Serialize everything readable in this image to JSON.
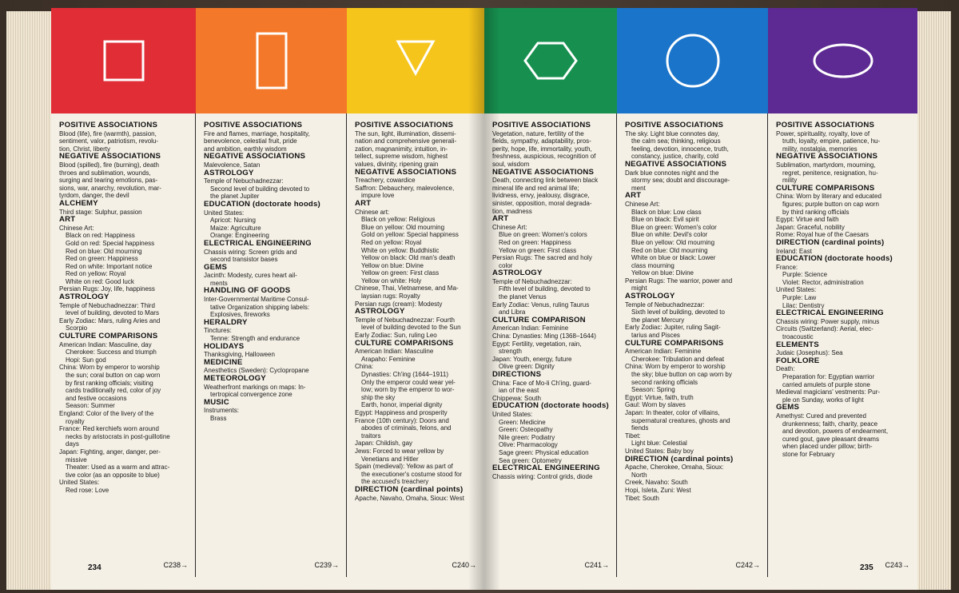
{
  "colors": {
    "red": "#e02d36",
    "orange": "#f3782a",
    "yellow": "#f6c51c",
    "green": "#17904f",
    "blue": "#1a74c9",
    "purple": "#5c2a92"
  },
  "columns": [
    {
      "id": "red",
      "shape": "square",
      "xref": "C238→",
      "sections": [
        {
          "h": "POSITIVE ASSOCIATIONS",
          "lines": [
            "Blood (life), fire (warmth), passion,",
            "sentiment, valor, patriotism, revolu-",
            "tion, Christ, liberty"
          ]
        },
        {
          "h": "NEGATIVE ASSOCIATIONS",
          "lines": [
            "Blood (spilled), fire (burning), death",
            "throes and sublimation, wounds,",
            "surging and tearing emotions, pas-",
            "sions, war, anarchy, revolution, mar-",
            "tyrdom, danger, the devil"
          ]
        },
        {
          "h": "ALCHEMY",
          "lines": [
            "Third stage: Sulphur, passion"
          ]
        },
        {
          "h": "ART",
          "lines": [
            "Chinese Art:",
            "  Black on red: Happiness",
            "  Gold on red: Special happiness",
            "  Red on blue: Old mourning",
            "  Red on green: Happiness",
            "  Red on white: Important notice",
            "  Red on yellow: Royal",
            "  White on red: Good luck",
            "Persian Rugs: Joy, life, happiness"
          ]
        },
        {
          "h": "ASTROLOGY",
          "lines": [
            "Temple of Nebuchadnezzar: Third",
            "  level of building, devoted to Mars",
            "Early Zodiac: Mars, ruling Aries and",
            "  Scorpio"
          ]
        },
        {
          "h": "CULTURE COMPARISONS",
          "lines": [
            "American Indian: Masculine, day",
            "  Cherokee: Success and triumph",
            "  Hopi: Sun god",
            "China: Worn by emperor to worship",
            "  the sun; coral button on cap worn",
            "  by first ranking officials; visiting",
            "  cards traditionally red, color of joy",
            "  and festive occasions",
            "  Season: Summer",
            "England: Color of the livery of the",
            "  royalty",
            "France: Red kerchiefs worn around",
            "  necks by aristocrats in post-guillotine",
            "  days",
            "Japan: Fighting, anger, danger, per-",
            "  missive",
            "  Theater: Used as a warm and attrac-",
            "  tive color (as an opposite to blue)",
            "United States:",
            "  Red rose: Love"
          ]
        }
      ]
    },
    {
      "id": "orange",
      "shape": "rectangle",
      "xref": "C239→",
      "sections": [
        {
          "h": "POSITIVE ASSOCIATIONS",
          "lines": [
            "Fire and flames, marriage, hospitality,",
            "benevolence, celestial fruit, pride",
            "and ambition, earthly wisdom"
          ]
        },
        {
          "h": "NEGATIVE ASSOCIATIONS",
          "lines": [
            "Malevolence, Satan"
          ]
        },
        {
          "h": "ASTROLOGY",
          "lines": [
            "Temple of Nebuchadnezzar:",
            "  Second level of building devoted to",
            "  the planet Jupiter"
          ]
        },
        {
          "h": "EDUCATION (doctorate hoods)",
          "lines": [
            "United States:",
            "  Apricot: Nursing",
            "  Maize: Agriculture",
            "  Orange: Engineering"
          ]
        },
        {
          "h": "ELECTRICAL ENGINEERING",
          "lines": [
            "Chassis wiring: Screen grids and",
            "  second transistor bases"
          ]
        },
        {
          "h": "GEMS",
          "lines": [
            "Jacinth: Modesty, cures heart ail-",
            "  ments"
          ]
        },
        {
          "h": "HANDLING OF GOODS",
          "lines": [
            "Inter-Governmental Maritime Consul-",
            "  tative Organization shipping labels:",
            "  Explosives, fireworks"
          ]
        },
        {
          "h": "HERALDRY",
          "lines": [
            "Tinctures:",
            "  Tenne: Strength and endurance"
          ]
        },
        {
          "h": "HOLIDAYS",
          "lines": [
            "Thanksgiving, Halloween"
          ]
        },
        {
          "h": "MEDICINE",
          "lines": [
            "Anesthetics (Sweden): Cyclopropane"
          ]
        },
        {
          "h": "METEOROLOGY",
          "lines": [
            "Weatherfront markings on maps: In-",
            "  tertropical convergence zone"
          ]
        },
        {
          "h": "MUSIC",
          "lines": [
            "Instruments:",
            "  Brass"
          ]
        }
      ]
    },
    {
      "id": "yellow",
      "shape": "triangle",
      "xref": "C240→",
      "sections": [
        {
          "h": "POSITIVE ASSOCIATIONS",
          "lines": [
            "The sun, light, illumination, dissemi-",
            "nation and comprehensive generali-",
            "zation, magnanimity, intuition, in-",
            "tellect, supreme wisdom, highest",
            "values, divinity, ripening grain"
          ]
        },
        {
          "h": "NEGATIVE ASSOCIATIONS",
          "lines": [
            "Treachery, cowardice",
            "Saffron: Debauchery, malevolence,",
            "  impure love"
          ]
        },
        {
          "h": "ART",
          "lines": [
            "Chinese art:",
            "  Black on yellow: Religious",
            "  Blue on yellow: Old mourning",
            "  Gold on yellow: Special happiness",
            "  Red on yellow: Royal",
            "  White on yellow: Buddhistic",
            "  Yellow on black: Old man's death",
            "  Yellow on blue: Divine",
            "  Yellow on green: First class",
            "  Yellow on white: Holy",
            "Chinese, Thai, Vietnamese, and Ma-",
            "  laysian rugs: Royalty",
            "Persian rugs (cream): Modesty"
          ]
        },
        {
          "h": "ASTROLOGY",
          "lines": [
            "Temple of Nebuchadnezzar: Fourth",
            "  level of building devoted to the Sun",
            "Early Zodiac: Sun, ruling Leo"
          ]
        },
        {
          "h": "CULTURE COMPARISONS",
          "lines": [
            "American Indian: Masculine",
            "  Arapaho: Feminine",
            "China:",
            "  Dynasties: Ch'ing (1644–1911)",
            "  Only the emperor could wear yel-",
            "  low; worn by the emperor to wor-",
            "  ship the sky",
            "  Earth, honor, imperial dignity",
            "Egypt: Happiness and prosperity",
            "France (10th century): Doors and",
            "  abodes of criminals, felons, and",
            "  traitors",
            "Japan: Childish, gay",
            "Jews: Forced to wear yellow by",
            "  Venetians and Hitler",
            "Spain (medieval): Yellow as part of",
            "  the executioner's costume stood for",
            "  the accused's treachery"
          ]
        },
        {
          "h": "DIRECTION (cardinal points)",
          "lines": [
            "Apache, Navaho, Omaha, Sioux: West"
          ]
        }
      ]
    },
    {
      "id": "green",
      "shape": "hexagon",
      "xref": "C241→",
      "sections": [
        {
          "h": "POSITIVE ASSOCIATIONS",
          "lines": [
            "Vegetation, nature, fertility of the",
            "fields, sympathy, adaptability, pros-",
            "perity, hope, life, immortality, youth,",
            "freshness, auspicious, recognition of",
            "soul, wisdom"
          ]
        },
        {
          "h": "NEGATIVE ASSOCIATIONS",
          "lines": [
            "Death, connecting link between black",
            "mineral life and red animal life;",
            "lividness, envy, jealousy, disgrace,",
            "sinister, opposition, moral degrada-",
            "tion, madness"
          ]
        },
        {
          "h": "ART",
          "lines": [
            "Chinese Art:",
            "  Blue on green: Women's colors",
            "  Red on green: Happiness",
            "  Yellow on green: First class",
            "Persian Rugs: The sacred and holy",
            "  color"
          ]
        },
        {
          "h": "ASTROLOGY",
          "lines": [
            "Temple of Nebuchadnezzar:",
            "  Fifth level of building, devoted to",
            "  the planet Venus",
            "Early Zodiac: Venus, ruling Taurus",
            "  and Libra"
          ]
        },
        {
          "h": "CULTURE COMPARISON",
          "lines": [
            "American Indian: Feminine",
            "China: Dynasties: Ming (1368–1644)",
            "Egypt: Fertility, vegetation, rain,",
            "  strength",
            "Japan: Youth, energy, future",
            "  Olive green: Dignity"
          ]
        },
        {
          "h": "DIRECTIONS",
          "lines": [
            "China: Face of Mo-li Ch'ing, guard-",
            "  ian of the east",
            "Chippewa: South"
          ]
        },
        {
          "h": "EDUCATION (doctorate hoods)",
          "lines": [
            "United States:",
            "  Green: Medicine",
            "  Green: Osteopathy",
            "  Nile green: Podiatry",
            "  Olive: Pharmacology",
            "  Sage green: Physical education",
            "  Sea green: Optometry"
          ]
        },
        {
          "h": "ELECTRICAL ENGINEERING",
          "lines": [
            "Chassis wiring: Control grids, diode"
          ]
        }
      ]
    },
    {
      "id": "blue",
      "shape": "circle",
      "xref": "C242→",
      "sections": [
        {
          "h": "POSITIVE ASSOCIATIONS",
          "lines": [
            "The sky. Light blue connotes day,",
            "  the calm sea; thinking, religious",
            "  feeling, devotion, innocence, truth,",
            "  constancy, justice, charity, cold"
          ]
        },
        {
          "h": "NEGATIVE ASSOCIATIONS",
          "lines": [
            "Dark blue connotes night and the",
            "  stormy sea; doubt and discourage-",
            "  ment"
          ]
        },
        {
          "h": "ART",
          "lines": [
            "Chinese Art:",
            "  Black on blue: Low class",
            "  Blue on black: Evil spirit",
            "  Blue on green: Women's color",
            "  Blue on white: Devil's color",
            "  Blue on yellow: Old mourning",
            "  Red on blue: Old mourning",
            "  White on blue or black: Lower",
            "  class mourning",
            "  Yellow on blue: Divine",
            "Persian Rugs: The warrior, power and",
            "  might"
          ]
        },
        {
          "h": "ASTROLOGY",
          "lines": [
            "Temple of Nebuchadnezzar:",
            "  Sixth level of building, devoted to",
            "  the planet Mercury",
            "Early Zodiac: Jupiter, ruling Sagit-",
            "  tarius and Pisces"
          ]
        },
        {
          "h": "CULTURE COMPARISONS",
          "lines": [
            "American Indian: Feminine",
            "  Cherokee: Tribulation and defeat",
            "China: Worn by emperor to worship",
            "  the sky; blue button on cap worn by",
            "  second ranking officials",
            "  Season: Spring",
            "Egypt: Virtue, faith, truth",
            "Gaul: Worn by slaves",
            "Japan: In theater, color of villains,",
            "  supernatural creatures, ghosts and",
            "  fiends",
            "Tibet:",
            "  Light blue: Celestial",
            "United States: Baby boy"
          ]
        },
        {
          "h": "DIRECTION (cardinal points)",
          "lines": [
            "Apache, Cherokee, Omaha, Sioux:",
            "  North",
            "Creek, Navaho: South",
            "Hopi, Isleta, Zuni: West",
            "Tibet: South"
          ]
        }
      ]
    },
    {
      "id": "purple",
      "shape": "ellipse",
      "xref": "C243→",
      "sections": [
        {
          "h": "POSITIVE ASSOCIATIONS",
          "lines": [
            "Power, spirituality, royalty, love of",
            "  truth, loyalty, empire, patience, hu-",
            "  mility, nostalgia, memories"
          ]
        },
        {
          "h": "NEGATIVE ASSOCIATIONS",
          "lines": [
            "Sublimation, martyrdom, mourning,",
            "  regret, penitence, resignation, hu-",
            "  mility"
          ]
        },
        {
          "h": "CULTURE COMPARISONS",
          "lines": [
            "China: Worn by literary and educated",
            "  figures; purple button on cap worn",
            "  by third ranking officials",
            "Egypt: Virtue and faith",
            "Japan: Graceful, nobility",
            "Rome: Royal hue of the Caesars"
          ]
        },
        {
          "h": "DIRECTION (cardinal points)",
          "lines": [
            "Ireland: East"
          ]
        },
        {
          "h": "EDUCATION (doctorate hoods)",
          "lines": [
            "France:",
            "  Purple: Science",
            "  Violet: Rector, administration",
            "United States:",
            "  Purple: Law",
            "  Lilac: Dentistry"
          ]
        },
        {
          "h": "ELECTRICAL ENGINEERING",
          "lines": [
            "Chassis wiring: Power supply, minus",
            "Circuits (Switzerland): Aerial, elec-",
            "  troacoustic"
          ]
        },
        {
          "h": "ELEMENTS",
          "lines": [
            "Judaic (Josephus): Sea"
          ]
        },
        {
          "h": "FOLKLORE",
          "lines": [
            "Death:",
            "  Preparation for: Egyptian warrior",
            "  carried amulets of purple stone",
            "Medieval magicians' vestments: Pur-",
            "  ple on Sunday, works of light"
          ]
        },
        {
          "h": "GEMS",
          "lines": [
            "Amethyst: Cured and prevented",
            "  drunkenness; faith, charity, peace",
            "  and devotion, powers of endearment,",
            "  cured gout, gave pleasant dreams",
            "  when placed under pillow; birth-",
            "  stone for February"
          ]
        }
      ]
    }
  ],
  "page_numbers": {
    "left": "234",
    "right": "235"
  }
}
